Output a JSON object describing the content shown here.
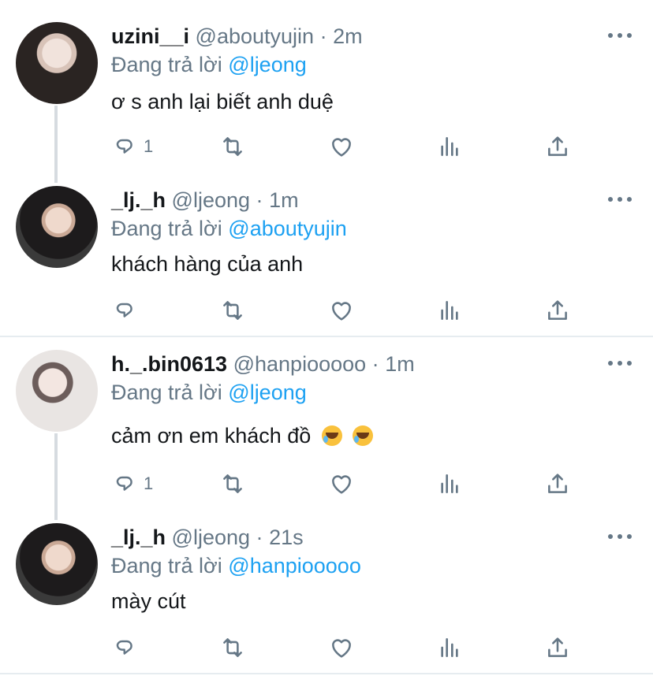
{
  "replies": [
    {
      "name": "uzini__i",
      "handle": "@aboutyujin",
      "time": "2m",
      "reply_prefix": "Đang trả lời",
      "reply_to": "@ljeong",
      "text": "ơ s anh lại biết anh duệ",
      "reply_count": "1"
    },
    {
      "name": "_lj._h",
      "handle": "@ljeong",
      "time": "1m",
      "reply_prefix": "Đang trả lời",
      "reply_to": "@aboutyujin",
      "text": "khách hàng của anh",
      "reply_count": ""
    },
    {
      "name": "h._.bin0613",
      "handle": "@hanpiooooo",
      "time": "1m",
      "reply_prefix": "Đang trả lời",
      "reply_to": "@ljeong",
      "text": "cảm ơn em khách đồ",
      "reply_count": "1"
    },
    {
      "name": "_lj._h",
      "handle": "@ljeong",
      "time": "21s",
      "reply_prefix": "Đang trả lời",
      "reply_to": "@hanpiooooo",
      "text": "mày cút",
      "reply_count": ""
    }
  ],
  "separator": "·",
  "icons": {
    "reply": "reply-icon",
    "retweet": "retweet-icon",
    "like": "heart-icon",
    "analytics": "analytics-icon",
    "share": "share-icon",
    "more": "more-icon"
  },
  "colors": {
    "link": "#1da1f2",
    "muted": "#657786",
    "thread_line": "#d6dbe0"
  }
}
